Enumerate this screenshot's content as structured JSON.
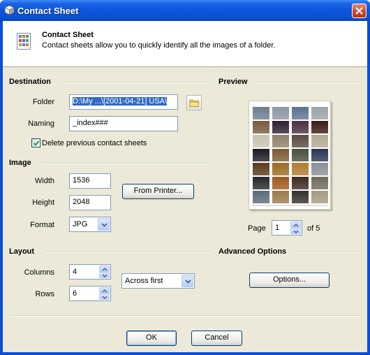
{
  "window": {
    "title": "Contact Sheet"
  },
  "header": {
    "title": "Contact Sheet",
    "description": "Contact sheets allow you to quickly identify all the images of a folder."
  },
  "destination": {
    "section_title": "Destination",
    "folder_label": "Folder",
    "folder_value": "D:\\My ...\\[2001-04-21] USA\\",
    "naming_label": "Naming",
    "naming_value": "_index###",
    "delete_previous_label": "Delete previous contact sheets",
    "delete_previous_checked": true
  },
  "image": {
    "section_title": "Image",
    "width_label": "Width",
    "width_value": "1536",
    "height_label": "Height",
    "height_value": "2048",
    "format_label": "Format",
    "format_value": "JPG",
    "from_printer_label": "From Printer..."
  },
  "layout": {
    "section_title": "Layout",
    "columns_label": "Columns",
    "columns_value": "4",
    "rows_label": "Rows",
    "rows_value": "6",
    "order_value": "Across first"
  },
  "preview": {
    "section_title": "Preview",
    "page_label": "Page",
    "page_value": "1",
    "of_label": "of 5",
    "thumbnail_colors": [
      "#6c7d8e",
      "#8a96a4",
      "#5b7391",
      "#9aa3a8",
      "#7a5a3c",
      "#2b1f30",
      "#4a3040",
      "#3a1a12",
      "#c9c2ad",
      "#8e7f6a",
      "#584a3f",
      "#b4a88f",
      "#1d1a24",
      "#7b5a32",
      "#46503c",
      "#2c3552",
      "#5a3a18",
      "#9c6a22",
      "#b07a2e",
      "#8a8f96",
      "#26282c",
      "#a05a1c",
      "#3b2a20",
      "#6e6a5a",
      "#5c6a7a",
      "#9b7a4c",
      "#35302c",
      "#a69a80"
    ]
  },
  "advanced": {
    "section_title": "Advanced Options",
    "options_label": "Options..."
  },
  "buttons": {
    "ok": "OK",
    "cancel": "Cancel"
  }
}
